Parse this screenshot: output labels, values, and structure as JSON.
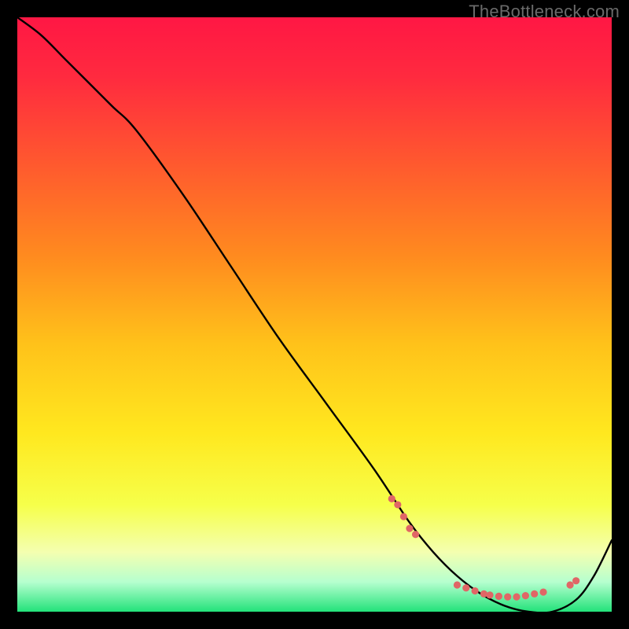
{
  "watermark": "TheBottleneck.com",
  "chart_data": {
    "type": "line",
    "title": "",
    "xlabel": "",
    "ylabel": "",
    "xlim": [
      0,
      100
    ],
    "ylim": [
      0,
      100
    ],
    "gradient_stops": [
      {
        "offset": 0.0,
        "color": "#ff1744"
      },
      {
        "offset": 0.1,
        "color": "#ff2a3f"
      },
      {
        "offset": 0.25,
        "color": "#ff5a2e"
      },
      {
        "offset": 0.4,
        "color": "#ff8a1f"
      },
      {
        "offset": 0.55,
        "color": "#ffc21a"
      },
      {
        "offset": 0.7,
        "color": "#ffe81f"
      },
      {
        "offset": 0.82,
        "color": "#f6ff4a"
      },
      {
        "offset": 0.9,
        "color": "#f4ffb0"
      },
      {
        "offset": 0.95,
        "color": "#b6ffcf"
      },
      {
        "offset": 1.0,
        "color": "#23e27a"
      }
    ],
    "series": [
      {
        "name": "bottleneck-curve",
        "x": [
          0,
          4,
          8,
          12,
          16,
          20,
          28,
          36,
          44,
          52,
          60,
          66,
          70,
          74,
          78,
          82,
          86,
          90,
          94,
          97,
          100
        ],
        "y": [
          100,
          97,
          93,
          89,
          85,
          81,
          70,
          58,
          46,
          35,
          24,
          15,
          10,
          6,
          3,
          1,
          0,
          0,
          2,
          6,
          12
        ]
      }
    ],
    "markers": {
      "name": "highlight-dots",
      "color": "#e06666",
      "radius": 4.6,
      "points": [
        {
          "x": 63,
          "y": 19
        },
        {
          "x": 64,
          "y": 18
        },
        {
          "x": 65,
          "y": 16
        },
        {
          "x": 66,
          "y": 14
        },
        {
          "x": 67,
          "y": 13
        },
        {
          "x": 74,
          "y": 4.5
        },
        {
          "x": 75.5,
          "y": 4
        },
        {
          "x": 77,
          "y": 3.5
        },
        {
          "x": 78.5,
          "y": 3
        },
        {
          "x": 79.5,
          "y": 2.8
        },
        {
          "x": 81,
          "y": 2.6
        },
        {
          "x": 82.5,
          "y": 2.5
        },
        {
          "x": 84,
          "y": 2.5
        },
        {
          "x": 85.5,
          "y": 2.7
        },
        {
          "x": 87,
          "y": 3
        },
        {
          "x": 88.5,
          "y": 3.3
        },
        {
          "x": 93,
          "y": 4.5
        },
        {
          "x": 94,
          "y": 5.2
        }
      ]
    }
  }
}
